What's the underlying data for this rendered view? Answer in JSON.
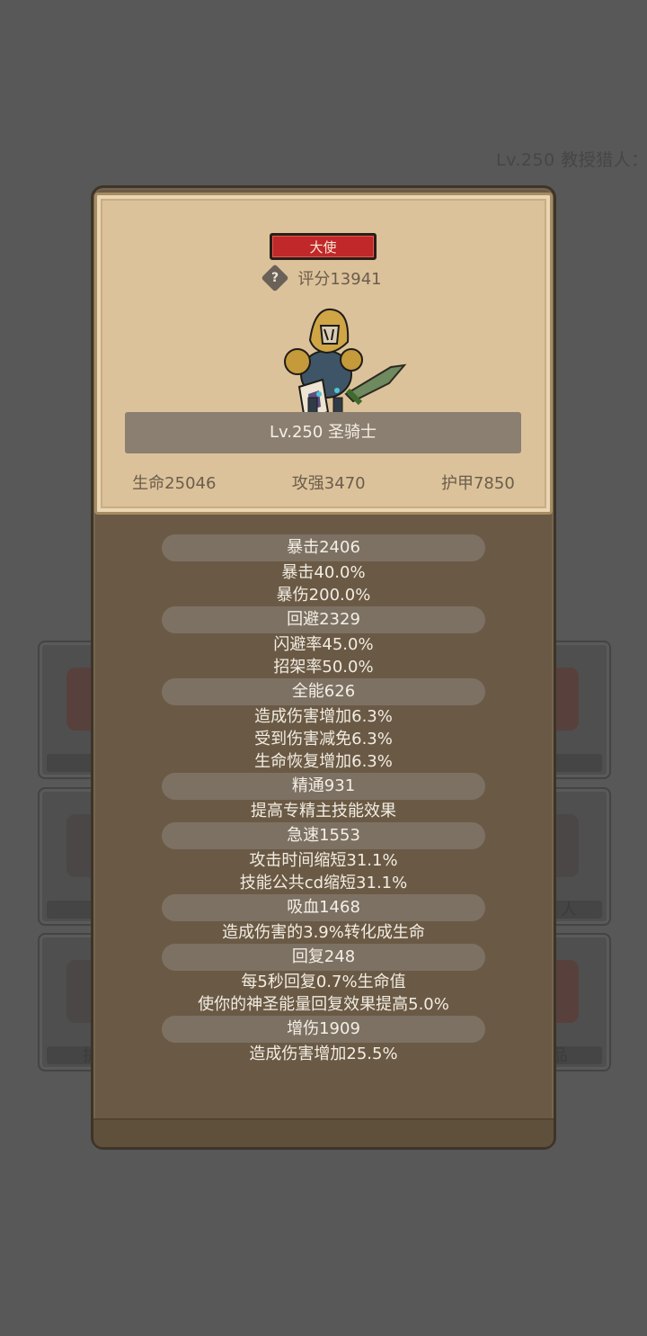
{
  "background": {
    "header": "Lv.250 教授猎人：",
    "slots": [
      {
        "label": ""
      },
      {
        "label": ""
      },
      {
        "label": "人"
      },
      {
        "label": ""
      },
      {
        "label": "护"
      },
      {
        "label": "品"
      }
    ]
  },
  "card": {
    "title_badge": "大使",
    "help_icon": "?",
    "score": "评分13941",
    "hero_level": "Lv.250 圣骑士",
    "hp": "生命25046",
    "attack": "攻强3470",
    "armor": "护甲7850"
  },
  "attributes": [
    {
      "name": "暴击2406",
      "lines": [
        "暴击40.0%",
        "暴伤200.0%"
      ]
    },
    {
      "name": "回避2329",
      "lines": [
        "闪避率45.0%",
        "招架率50.0%"
      ]
    },
    {
      "name": "全能626",
      "lines": [
        "造成伤害增加6.3%",
        "受到伤害减免6.3%",
        "生命恢复增加6.3%"
      ]
    },
    {
      "name": "精通931",
      "lines": [
        "提高专精主技能效果"
      ]
    },
    {
      "name": "急速1553",
      "lines": [
        "攻击时间缩短31.1%",
        "技能公共cd缩短31.1%"
      ]
    },
    {
      "name": "吸血1468",
      "lines": [
        "造成伤害的3.9%转化成生命"
      ]
    },
    {
      "name": "回复248",
      "lines": [
        "每5秒回复0.7%生命值",
        "使你的神圣能量回复效果提高5.0%"
      ]
    },
    {
      "name": "增伤1909",
      "lines": [
        "造成伤害增加25.5%"
      ]
    }
  ],
  "colors": {
    "badge_red": "#c0282a",
    "card_parchment": "#dcc29a",
    "panel_brown": "#6a5a45",
    "overlay_gray": "#585858"
  }
}
